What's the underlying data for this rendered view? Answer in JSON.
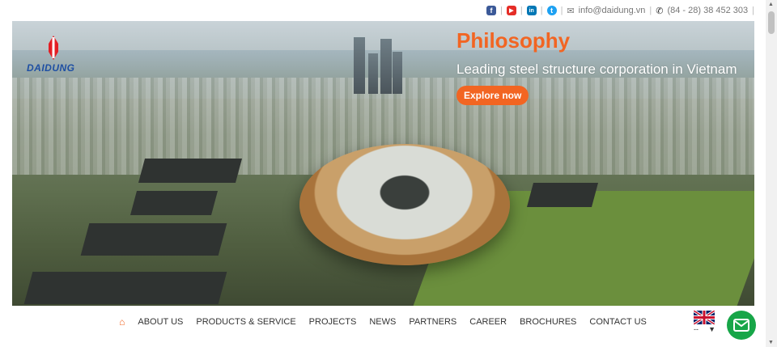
{
  "topbar": {
    "social": [
      {
        "name": "facebook-icon",
        "glyph": "f",
        "color": "#3b5998"
      },
      {
        "name": "youtube-icon",
        "glyph": "▶",
        "color": "#e52d27"
      },
      {
        "name": "linkedin-icon",
        "glyph": "in",
        "color": "#0077b5"
      },
      {
        "name": "twitter-icon",
        "glyph": "t",
        "color": "#1da1f2"
      }
    ],
    "email": "info@daidung.vn",
    "phone": "(84 - 28) 38 452 303"
  },
  "logo": {
    "text": "DAIDUNG"
  },
  "hero": {
    "title": "Philosophy",
    "subtitle": "Leading steel structure corporation in Vietnam",
    "button": "Explore now"
  },
  "nav": {
    "items": [
      "ABOUT US",
      "PRODUCTS & SERVICE",
      "PROJECTS",
      "NEWS",
      "PARTNERS",
      "CAREER",
      "BROCHURES",
      "CONTACT US"
    ]
  },
  "lang": {
    "selected": "--"
  },
  "colors": {
    "accent": "#f26522",
    "brand_blue": "#1e4fa3",
    "mail_green": "#17a648"
  }
}
